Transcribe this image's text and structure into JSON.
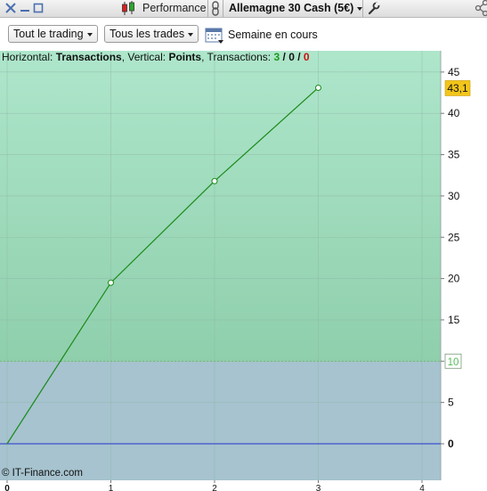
{
  "window": {
    "performance_tab": "Performance",
    "instrument": "Allemagne 30 Cash (5€)"
  },
  "toolbar": {
    "scope_dropdown": "Tout le trading",
    "trades_dropdown": "Tous les trades",
    "period_label": "Semaine en cours"
  },
  "info": {
    "horizontal_label": "Horizontal:",
    "horizontal_value": "Transactions",
    "vertical_label": ", Vertical:",
    "vertical_value": "Points",
    "transactions_label": ", Transactions:",
    "count_won": "3",
    "sep1": " / ",
    "count_neutral": "0",
    "sep2": " / ",
    "count_lost": "0"
  },
  "watermark": "© IT-Finance.com",
  "colors": {
    "positive_zone": "#a8e2c6",
    "negative_zone": "#a6c3cf",
    "equity_line": "#1a8a1a",
    "zero_line": "#2233cc",
    "last_value_badge": "#f3c51a",
    "target_label": "#55bb55"
  },
  "chart_data": {
    "type": "line",
    "x": [
      0,
      1,
      2,
      3
    ],
    "y": [
      0,
      19.5,
      31.8,
      43.1
    ],
    "series": [
      {
        "values": [
          0,
          19.5,
          31.8,
          43.1
        ]
      }
    ],
    "xlim": [
      0,
      4.2
    ],
    "ylim": [
      -4.5,
      48
    ],
    "x_ticks": [
      "0",
      "1",
      "2",
      "3",
      "4"
    ],
    "y_ticks": [
      "0",
      "5",
      "10",
      "15",
      "20",
      "25",
      "30",
      "35",
      "40",
      "45"
    ],
    "y_tick_values": [
      0,
      5,
      10,
      15,
      20,
      25,
      30,
      35,
      40,
      45
    ],
    "x_tick_values": [
      0,
      1,
      2,
      3,
      4
    ],
    "last_value_label": "43,1",
    "target_value": 10,
    "target_label": "10",
    "zero_line": 0,
    "grid": true
  }
}
